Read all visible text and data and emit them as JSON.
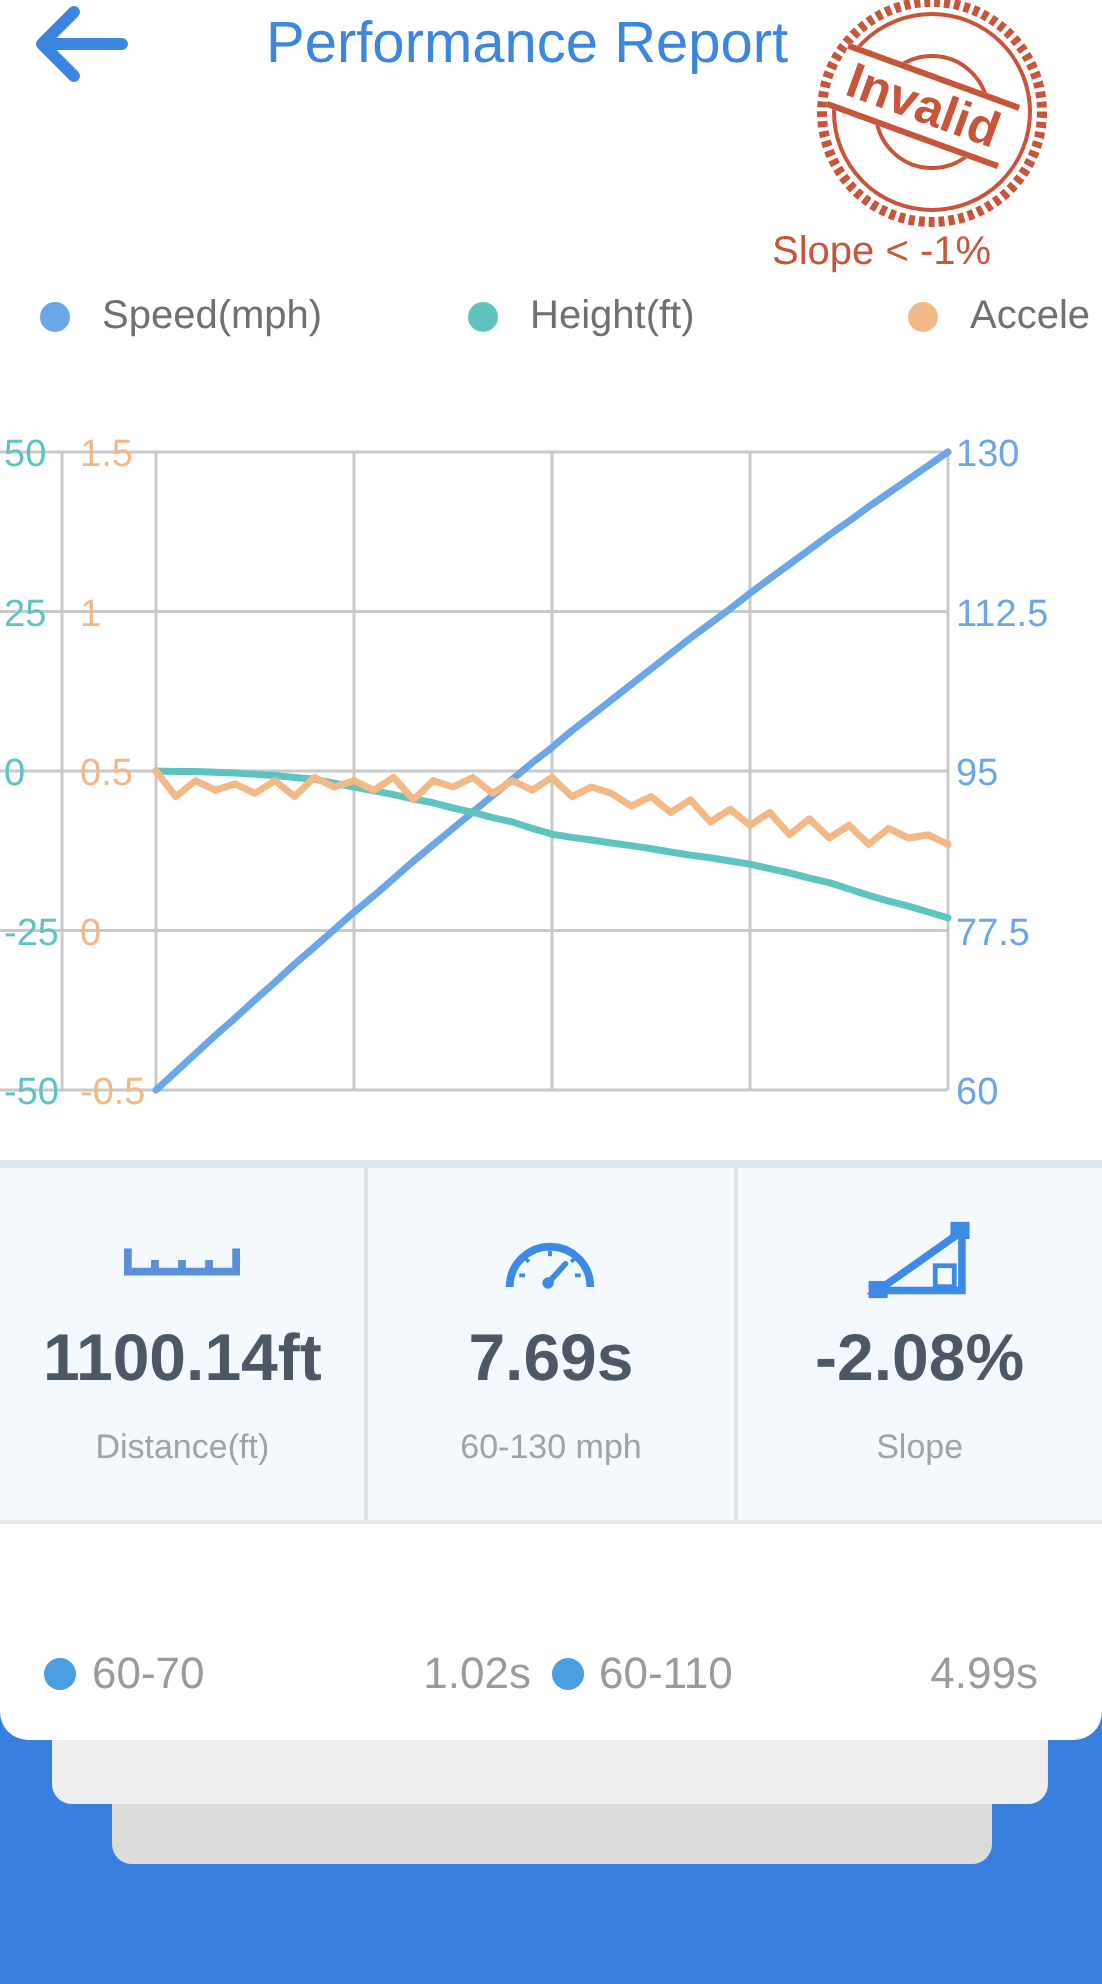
{
  "header": {
    "title": "Performance Report",
    "stamp": "Invalid",
    "stamp_note": "Slope < -1%"
  },
  "chart": {
    "chart_data": {
      "type": "line",
      "grid": true,
      "categories": [
        null,
        null,
        null,
        null,
        null,
        null,
        null,
        null,
        null,
        null,
        null,
        null,
        null,
        null,
        null,
        null,
        null,
        null,
        null,
        null,
        null,
        null,
        null,
        null,
        null,
        null,
        null,
        null,
        null,
        null,
        null,
        null,
        null,
        null,
        null,
        null,
        null,
        null,
        null,
        null,
        null
      ],
      "ylim": [
        60,
        130
      ],
      "yticks": [
        130,
        112.5,
        95,
        77.5,
        60
      ],
      "y2lim": [
        -50,
        50
      ],
      "y2ticks": [
        50,
        25,
        0,
        -25,
        -50
      ],
      "y3lim": [
        -0.5,
        1.5
      ],
      "y3ticks": [
        1.5,
        1,
        0.5,
        0,
        -0.5
      ],
      "series": [
        {
          "name": "Speed(mph)",
          "color": "#6aa6e8",
          "values": [
            60,
            62.0,
            64.0,
            66.0,
            67.9,
            69.9,
            71.8,
            73.8,
            75.7,
            77.6,
            79.5,
            81.3,
            83.2,
            85.1,
            86.9,
            88.7,
            90.5,
            92.3,
            94.1,
            95.9,
            97.6,
            99.4,
            101.1,
            102.8,
            104.5,
            106.2,
            107.9,
            109.6,
            111.2,
            112.8,
            114.5,
            116.1,
            117.7,
            119.3,
            120.9,
            122.4,
            124.0,
            125.5,
            127.0,
            128.5,
            130
          ]
        },
        {
          "name": "Height(ft)",
          "color": "#5ec4c0",
          "axis": "y2",
          "values": [
            0,
            -0.05,
            -0.1,
            -0.2,
            -0.3,
            -0.5,
            -0.7,
            -1,
            -1.3,
            -1.9,
            -2.5,
            -3.1,
            -3.7,
            -4.4,
            -5,
            -5.8,
            -6.5,
            -7.3,
            -8,
            -9,
            -9.9,
            -10.4,
            -10.8,
            -11.3,
            -11.7,
            -12.2,
            -12.7,
            -13.2,
            -13.6,
            -14.1,
            -14.6,
            -15.3,
            -16,
            -16.8,
            -17.5,
            -18.5,
            -19.5,
            -20.4,
            -21.2,
            -22.1,
            -23
          ]
        },
        {
          "name": "Accele",
          "color": "#f2b987",
          "axis": "y3",
          "values": [
            0.5,
            0.42,
            0.47,
            0.44,
            0.46,
            0.43,
            0.47,
            0.42,
            0.48,
            0.45,
            0.47,
            0.44,
            0.48,
            0.41,
            0.47,
            0.45,
            0.48,
            0.43,
            0.47,
            0.44,
            0.48,
            0.42,
            0.45,
            0.43,
            0.39,
            0.42,
            0.37,
            0.41,
            0.34,
            0.38,
            0.33,
            0.37,
            0.3,
            0.35,
            0.29,
            0.33,
            0.27,
            0.32,
            0.29,
            0.3,
            0.27
          ]
        }
      ]
    }
  },
  "stats": [
    {
      "kind": "distance",
      "value": "1100.14ft",
      "label": "Distance(ft)"
    },
    {
      "kind": "time",
      "value": "7.69s",
      "label": "60-130 mph"
    },
    {
      "kind": "slope",
      "value": "-2.08%",
      "label": "Slope"
    }
  ],
  "splits": [
    {
      "label": "60-70",
      "time": "1.02s",
      "color": "#4a9fe0"
    },
    {
      "label": "60-110",
      "time": "4.99s",
      "color": "#4a9fe0"
    }
  ]
}
